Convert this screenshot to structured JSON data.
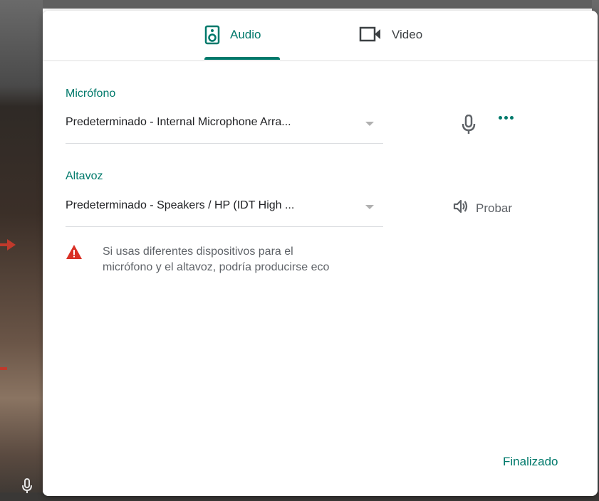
{
  "tabs": [
    {
      "label": "Audio",
      "icon": "speaker-icon",
      "active": true
    },
    {
      "label": "Video",
      "icon": "video-camera-icon",
      "active": false
    }
  ],
  "microphone": {
    "label": "Micrófono",
    "selected": "Predeterminado - Internal Microphone Arra..."
  },
  "speaker": {
    "label": "Altavoz",
    "selected": "Predeterminado - Speakers / HP (IDT High ...",
    "test_label": "Probar"
  },
  "warning": {
    "line1": "Si usas diferentes dispositivos para el",
    "line2": "micrófono y el altavoz, podría producirse eco"
  },
  "done_label": "Finalizado",
  "colors": {
    "accent": "#00796b",
    "warning": "#d93025",
    "text": "#202124",
    "muted": "#5f6368",
    "annotation_arrow": "#c0392b"
  }
}
